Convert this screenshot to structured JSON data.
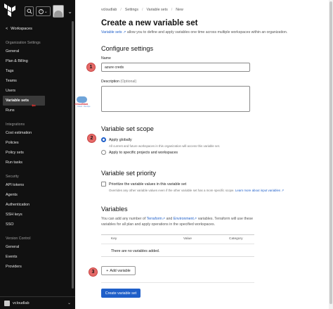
{
  "header": {
    "breadcrumb": [
      "vcloudlab",
      "Settings",
      "Variable sets",
      "New"
    ],
    "chevron_glyph": "⌄",
    "help_glyph": "?"
  },
  "sidebar": {
    "back_label": "Workspaces",
    "back_glyph": "<",
    "sections": [
      {
        "title": "Organization Settings",
        "items": [
          "General",
          "Plan & Billing",
          "Tags",
          "Teams",
          "Users",
          "Variable sets",
          "Runs"
        ]
      },
      {
        "title": "Integrations",
        "items": [
          "Cost estimation",
          "Policies",
          "Policy sets",
          "Run tasks"
        ]
      },
      {
        "title": "Security",
        "items": [
          "API tokens",
          "Agents",
          "Authentication",
          "SSH keys",
          "SSO"
        ]
      },
      {
        "title": "Version Control",
        "items": [
          "General",
          "Events",
          "Providers"
        ]
      }
    ],
    "active_item": "Variable sets",
    "org_name": "vcloudlab"
  },
  "page": {
    "title": "Create a new variable set",
    "description_link": "Variable sets",
    "description_rest": "allow you to define and apply variables one time across multiple workspaces within an organization.",
    "configure_heading": "Configure settings",
    "name_label": "Name",
    "name_value": "azure creds",
    "description_label": "Description",
    "description_optional": "(Optional)",
    "scope_heading": "Variable set scope",
    "apply_globally": "Apply globally",
    "apply_globally_help": "All current and future workspaces in this organization will access this variable set.",
    "apply_specific": "Apply to specific projects and workspaces",
    "priority_heading": "Variable set priority",
    "priority_checkbox": "Prioritize the variable values in this variable set",
    "priority_help": "Overrides any other variable values even if the other variable set has a more specific scope.",
    "priority_help_link": "Learn more about input variables",
    "variables_heading": "Variables",
    "variables_desc_1": "You can add any number of",
    "variables_link_terraform": "Terraform",
    "variables_and": "and",
    "variables_link_env": "Environment",
    "variables_desc_2": "variables. Terraform will use these variables for all plan and apply operations in the specified workspaces.",
    "table_headers": [
      "Key",
      "Value",
      "Category"
    ],
    "table_empty": "There are no variables added.",
    "add_variable_label": "Add variable",
    "create_button_label": "Create variable set"
  },
  "annotations": {
    "step_numbers": [
      "1",
      "2",
      "3"
    ],
    "arrow_glyph": "⇐"
  },
  "colors": {
    "sidebar_bg": "#111111",
    "accent": "#1f5fc9",
    "annotation_red": "#e56a68"
  }
}
